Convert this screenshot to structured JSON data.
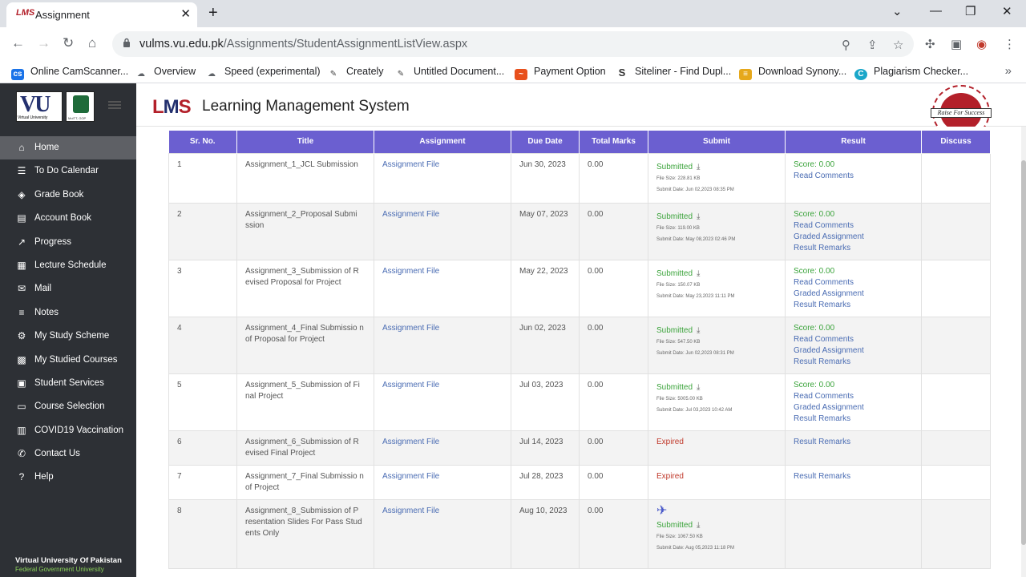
{
  "browser": {
    "tab_title": "Assignment",
    "tab_icon": "LMS",
    "url_domain": "vulms.vu.edu.pk",
    "url_path": "/Assignments/StudentAssignmentListView.aspx",
    "bookmarks": [
      {
        "label": "Online CamScanner...",
        "icon": "cs-icon",
        "color": "#1a73e8"
      },
      {
        "label": "Overview",
        "icon": "speed-icon",
        "color": "#5f6368"
      },
      {
        "label": "Speed (experimental)",
        "icon": "speed-icon",
        "color": "#5f6368"
      },
      {
        "label": "Creately",
        "icon": "creately-icon",
        "color": "#444"
      },
      {
        "label": "Untitled Document...",
        "icon": "doc-icon",
        "color": "#444"
      },
      {
        "label": "Payment Option",
        "icon": "payment-icon",
        "color": "#e8501c"
      },
      {
        "label": "Siteliner - Find Dupl...",
        "icon": "siteliner-icon",
        "color": "#333"
      },
      {
        "label": "Download Synony...",
        "icon": "download-icon",
        "color": "#e6a81b"
      },
      {
        "label": "Plagiarism Checker...",
        "icon": "plagiarism-icon",
        "color": "#1aa7c9"
      }
    ]
  },
  "sidebar": {
    "logo_text": "VU",
    "logo_sub": "Virtual University",
    "govt_sub": "MoITT, GOP",
    "items": [
      {
        "label": "Home",
        "icon": "home-icon",
        "glyph": "⌂",
        "active": true
      },
      {
        "label": "To Do Calendar",
        "icon": "list-icon",
        "glyph": "☰"
      },
      {
        "label": "Grade Book",
        "icon": "layers-icon",
        "glyph": "◈"
      },
      {
        "label": "Account Book",
        "icon": "account-icon",
        "glyph": "▤"
      },
      {
        "label": "Progress",
        "icon": "chart-icon",
        "glyph": "↗"
      },
      {
        "label": "Lecture Schedule",
        "icon": "calendar-icon",
        "glyph": "▦"
      },
      {
        "label": "Mail",
        "icon": "mail-icon",
        "glyph": "✉"
      },
      {
        "label": "Notes",
        "icon": "notes-icon",
        "glyph": "≡"
      },
      {
        "label": "My Study Scheme",
        "icon": "settings-icon",
        "glyph": "⚙"
      },
      {
        "label": "My Studied Courses",
        "icon": "grid-icon",
        "glyph": "▩"
      },
      {
        "label": "Student Services",
        "icon": "services-icon",
        "glyph": "▣"
      },
      {
        "label": "Course Selection",
        "icon": "selection-icon",
        "glyph": "▭"
      },
      {
        "label": "COVID19 Vaccination",
        "icon": "vaccine-icon",
        "glyph": "▥"
      },
      {
        "label": "Contact Us",
        "icon": "phone-icon",
        "glyph": "✆"
      },
      {
        "label": "Help",
        "icon": "help-icon",
        "glyph": "?"
      }
    ],
    "footer_title": "Virtual University Of Pakistan",
    "footer_sub": "Federal Government University"
  },
  "header": {
    "logo_l": "L",
    "logo_m": "M",
    "logo_s": "S",
    "title": "Learning Management System",
    "badge_text": "Raise For Success"
  },
  "table": {
    "columns": [
      "Sr. No.",
      "Title",
      "Assignment",
      "Due Date",
      "Total Marks",
      "Submit",
      "Result",
      "Discuss"
    ],
    "rows": [
      {
        "sr": "1",
        "title": "Assignment_1_JCL Submission",
        "file": "Assignment File",
        "due": "Jun 30, 2023",
        "marks": "0.00",
        "status": "Submitted",
        "size": "File Size: 228.81 KB",
        "date": "Submit Date: Jun 02,2023 08:35 PM",
        "result": [
          "Score: 0.00",
          "Read Comments"
        ]
      },
      {
        "sr": "2",
        "title": "Assignment_2_Proposal Submi ssion",
        "file": "Assignment File",
        "due": "May 07, 2023",
        "marks": "0.00",
        "status": "Submitted",
        "size": "File Size: 119.00 KB",
        "date": "Submit Date: May 08,2023 02:46 PM",
        "result": [
          "Score: 0.00",
          "Read Comments",
          "Graded Assignment",
          "Result Remarks"
        ]
      },
      {
        "sr": "3",
        "title": "Assignment_3_Submission of R evised Proposal for Project",
        "file": "Assignment File",
        "due": "May 22, 2023",
        "marks": "0.00",
        "status": "Submitted",
        "size": "File Size: 150.07 KB",
        "date": "Submit Date: May 23,2023 11:11 PM",
        "result": [
          "Score: 0.00",
          "Read Comments",
          "Graded Assignment",
          "Result Remarks"
        ]
      },
      {
        "sr": "4",
        "title": "Assignment_4_Final Submissio n of Proposal for Project",
        "file": "Assignment File",
        "due": "Jun 02, 2023",
        "marks": "0.00",
        "status": "Submitted",
        "size": "File Size: 547.50 KB",
        "date": "Submit Date: Jun 02,2023 08:31 PM",
        "result": [
          "Score: 0.00",
          "Read Comments",
          "Graded Assignment",
          "Result Remarks"
        ]
      },
      {
        "sr": "5",
        "title": "Assignment_5_Submission of Fi nal Project",
        "file": "Assignment File",
        "due": "Jul 03, 2023",
        "marks": "0.00",
        "status": "Submitted",
        "size": "File Size: 5005.00 KB",
        "date": "Submit Date: Jul 03,2023 10:42 AM",
        "result": [
          "Score: 0.00",
          "Read Comments",
          "Graded Assignment",
          "Result Remarks"
        ]
      },
      {
        "sr": "6",
        "title": "Assignment_6_Submission of R evised Final Project",
        "file": "Assignment File",
        "due": "Jul 14, 2023",
        "marks": "0.00",
        "status": "Expired",
        "result": [
          "Result Remarks"
        ]
      },
      {
        "sr": "7",
        "title": "Assignment_7_Final Submissio n of Project",
        "file": "Assignment File",
        "due": "Jul 28, 2023",
        "marks": "0.00",
        "status": "Expired",
        "result": [
          "Result Remarks"
        ]
      },
      {
        "sr": "8",
        "title": "Assignment_8_Submission of P resentation Slides For Pass Stud ents Only",
        "file": "Assignment File",
        "due": "Aug 10, 2023",
        "marks": "0.00",
        "status": "Submitted",
        "upload": true,
        "size": "File Size: 1067.50 KB",
        "date": "Submit Date: Aug 05,2023 11:18 PM",
        "result": []
      }
    ]
  },
  "colors": {
    "table_header": "#6b5fd0",
    "sidebar_bg": "#2d3035",
    "submitted": "#3aa33a",
    "due_date": "#c0392b",
    "link": "#4a6cb3"
  }
}
